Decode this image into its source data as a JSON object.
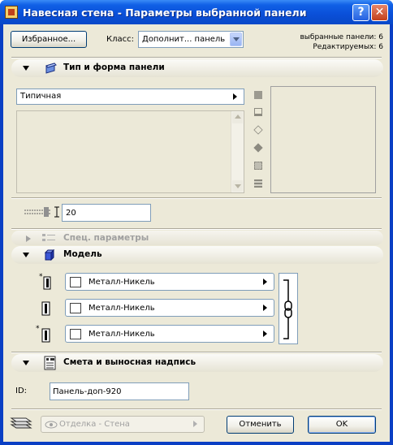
{
  "window": {
    "title": "Навесная стена - Параметры выбранной панели",
    "help_glyph": "?",
    "close_glyph": "✕"
  },
  "top": {
    "favorites_button": "Избранное...",
    "class_label": "Класс:",
    "class_value": "Дополнит... панель",
    "selected_panels": "выбранные панели: 6",
    "editable": "Редактируемых: 6"
  },
  "section_type": {
    "title": "Тип и форма панели",
    "type_value": "Типичная",
    "dimension_value": "20"
  },
  "section_special": {
    "title": "Спец. параметры"
  },
  "section_model": {
    "title": "Модель",
    "materials": [
      {
        "name": "Металл-Никель"
      },
      {
        "name": "Металл-Никель"
      },
      {
        "name": "Металл-Никель"
      }
    ]
  },
  "section_listing": {
    "title": "Смета и выносная надпись",
    "id_label": "ID:",
    "id_value": "Панель-доп-920"
  },
  "bottom": {
    "layer_value": "Отделка - Стена",
    "cancel_button": "Отменить",
    "ok_button": "OK"
  },
  "colors": {
    "titlebar": "#0a4fd8",
    "dialog_bg": "#ece9d8",
    "disabled_text": "#a0a0a0"
  }
}
